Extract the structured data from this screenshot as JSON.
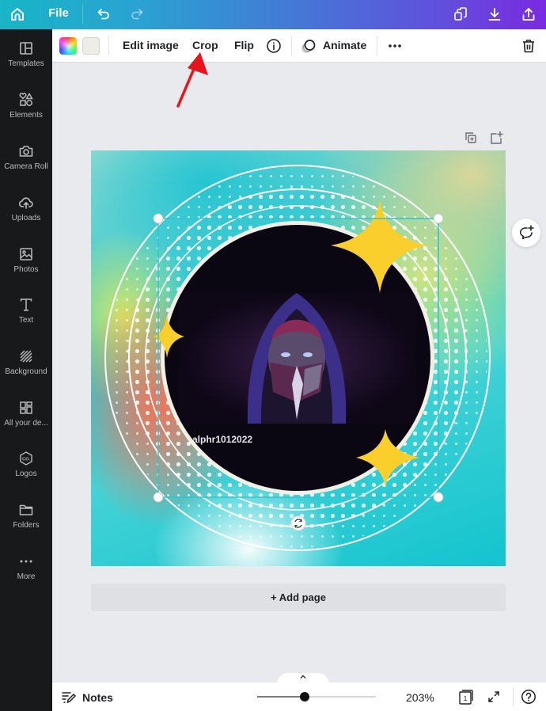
{
  "topbar": {
    "file_label": "File",
    "icons": [
      "home-icon",
      "undo-icon",
      "redo-icon",
      "resize-icon",
      "download-icon",
      "share-icon"
    ]
  },
  "sidebar": {
    "items": [
      {
        "label": "Templates",
        "icon": "templates-icon"
      },
      {
        "label": "Elements",
        "icon": "elements-icon"
      },
      {
        "label": "Camera Roll",
        "icon": "camera-icon"
      },
      {
        "label": "Uploads",
        "icon": "upload-cloud-icon"
      },
      {
        "label": "Photos",
        "icon": "photo-icon"
      },
      {
        "label": "Text",
        "icon": "text-icon"
      },
      {
        "label": "Background",
        "icon": "background-icon"
      },
      {
        "label": "All your de...",
        "icon": "grid-icon"
      },
      {
        "label": "Logos",
        "icon": "logo-icon"
      },
      {
        "label": "Folders",
        "icon": "folder-icon"
      },
      {
        "label": "More",
        "icon": "more-icon"
      }
    ]
  },
  "toolbar": {
    "edit_image": "Edit image",
    "crop": "Crop",
    "flip": "Flip",
    "animate": "Animate",
    "swatch_color": "#eeeee6"
  },
  "canvas": {
    "watermark_text": "alphr1012022",
    "selection_color": "#2ec4d3",
    "star_color": "#fbcf2b"
  },
  "add_page_label": "+ Add page",
  "bottombar": {
    "notes_label": "Notes",
    "zoom_percent": "203%",
    "zoom_slider_fraction": 0.4,
    "page_count": "1"
  },
  "annotation": {
    "arrow_color": "#e8141c",
    "points_to": "Crop"
  }
}
